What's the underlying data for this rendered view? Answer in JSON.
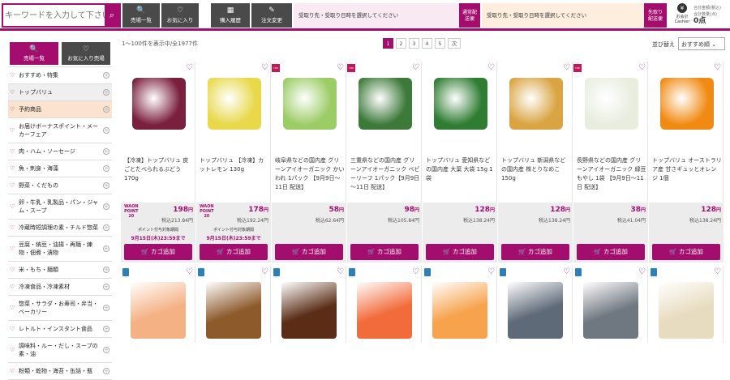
{
  "header": {
    "search_placeholder": "キーワードを入力して下さい",
    "search_icon": "search-icon",
    "buttons": [
      {
        "id": "sale-list",
        "icon": "🔍",
        "label": "売場一覧"
      },
      {
        "id": "favorites",
        "icon": "♡",
        "label": "お気に入り"
      },
      {
        "id": "history",
        "icon": "▦",
        "label": "購入履歴"
      },
      {
        "id": "order-change",
        "icon": "✎",
        "label": "注文変更"
      }
    ],
    "delivery_prompt_1": "受取り先・受取り日時を選択してください",
    "delivery_btn_1": [
      "通常配",
      "送便"
    ],
    "delivery_prompt_2": "受取り先・受取り日時を選択してください",
    "delivery_btn_2": [
      "先取り",
      "配送便"
    ],
    "cashier_label": "お会計",
    "cashier_sub": "Cashier",
    "total_label_1": "合計金額(税込)",
    "total_label_2": "合計数量(点)",
    "total_value": "0点",
    "accent": "#a30d6e"
  },
  "sidebar": {
    "tabs": [
      {
        "icon": "🔍",
        "label": "売場一覧",
        "color": "#a30d6e"
      },
      {
        "icon": "♡",
        "label": "お気に入り売場",
        "color": "#4a4a4a"
      }
    ],
    "categories": [
      {
        "label": "おすすめ・特集",
        "h": 21,
        "bg": "#fff"
      },
      {
        "label": "トップバリュ",
        "h": 21,
        "bg": "#efefef"
      },
      {
        "label": "予約商品",
        "h": 21,
        "bg": "#fbe3cf"
      },
      {
        "label": "お届けボーナスポイント・メーカーフェア",
        "h": 31,
        "bg": "#fff"
      },
      {
        "label": "肉・ハム・ソーセージ",
        "h": 21,
        "bg": "#fff"
      },
      {
        "label": "魚・刺身・海藻",
        "h": 21,
        "bg": "#fff"
      },
      {
        "label": "野菜・くだもの",
        "h": 21,
        "bg": "#fff"
      },
      {
        "label": "卵・牛乳・乳製品・パン・ジャム・スープ",
        "h": 31,
        "bg": "#fff"
      },
      {
        "label": "冷蔵時短調理の素・チルド惣菜",
        "h": 21,
        "bg": "#fff"
      },
      {
        "label": "豆腐・納豆・油揚・再麺・練物・佃煮・漬物",
        "h": 31,
        "bg": "#fff"
      },
      {
        "label": "米・もち・麺類",
        "h": 21,
        "bg": "#fff"
      },
      {
        "label": "冷凍食品・冷凍素材",
        "h": 21,
        "bg": "#fff"
      },
      {
        "label": "惣菜・サラダ・お寿司・弁当・ベーカリー",
        "h": 31,
        "bg": "#fff"
      },
      {
        "label": "レトルト・インスタント食品",
        "h": 21,
        "bg": "#fff"
      },
      {
        "label": "調味料・ルー・だし・スープの素・油",
        "h": 31,
        "bg": "#fff"
      },
      {
        "label": "粉類・乾物・海苔・缶詰・瓶",
        "h": 21,
        "bg": "#fff"
      }
    ]
  },
  "main": {
    "result_count": "1～100件を表示中/全1977件",
    "pages": [
      "1",
      "2",
      "3",
      "4",
      "5",
      "次"
    ],
    "sort_label": "並び替え",
    "sort_value": "おすすめ順 ⌄"
  },
  "products": [
    {
      "name": "【冷凍】トップバリュ 皮ごとたべられるぶどう 170g",
      "price": "198",
      "tax": "税込213.84円",
      "waon": [
        "WAON",
        "POINT",
        "20"
      ],
      "point_note": "ポイント付与対象期間",
      "point_date": "9月15日(木)23:59まで",
      "badge": false,
      "img": "#7a1f3d"
    },
    {
      "name": "トップバリュ 【冷凍】カットレモン 130g",
      "price": "178",
      "tax": "税込192.24円",
      "waon": [
        "WAON",
        "POINT",
        "20"
      ],
      "point_note": "ポイント付与対象期間",
      "point_date": "9月15日(木)23:59まで",
      "badge": false,
      "img": "#e8d84a"
    },
    {
      "name": "岐阜県などの国内産 グリーンアイオーガニック かいわれ 1パック 【9月9日～11日 配送】",
      "price": "58",
      "tax": "税込62.64円",
      "badge": true,
      "img": "#9ccc65"
    },
    {
      "name": "三重県などの国内産 グリーンアイオーガニック ベビーリーフ 1パック【9月9日～11日 配送】",
      "price": "98",
      "tax": "税込105.84円",
      "badge": true,
      "img": "#3d7a3a"
    },
    {
      "name": "トップバリュ 愛知県などの国内産 大葉 大袋 15g 1袋",
      "price": "128",
      "tax": "税込138.24円",
      "badge": false,
      "img": "#2e7d32"
    },
    {
      "name": "トップバリュ 新潟県などの国内産 株とりなめこ 150g",
      "price": "128",
      "tax": "税込138.24円",
      "badge": false,
      "img": "#d9a441"
    },
    {
      "name": "長野県などの国内産 グリーンアイオーガニック 緑豆もやし 1袋 【9月9日～11日 配送】",
      "price": "38",
      "tax": "税込41.04円",
      "badge": true,
      "img": "#e9edde"
    },
    {
      "name": "トップバリュ オーストラリア産 甘さギュッとオレンジ 1個",
      "price": "128",
      "tax": "税込138.24円",
      "badge": false,
      "img": "#f08a12"
    }
  ],
  "row2": [
    {
      "img": "#f4b183"
    },
    {
      "img": "#8d5a2b"
    },
    {
      "img": "#5b2d16"
    },
    {
      "img": "#f26b3a"
    },
    {
      "img": "#f7a24c"
    },
    {
      "img": "#5f6a78"
    },
    {
      "img": "#6f7780"
    },
    {
      "img": "#e8dcc0"
    }
  ],
  "common": {
    "currency": "円",
    "cart_label": "カゴ追加"
  }
}
